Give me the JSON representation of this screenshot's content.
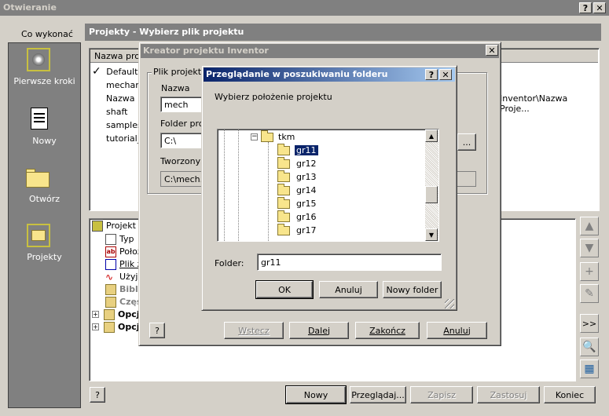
{
  "main_window": {
    "title": "Otwieranie",
    "help_btn": "?",
    "close_btn": "✕"
  },
  "left_panel": {
    "heading": "Co wykonać",
    "items": [
      {
        "label": "Pierwsze kroki",
        "icon": "getting-started-icon"
      },
      {
        "label": "Nowy",
        "icon": "new-document-icon"
      },
      {
        "label": "Otwórz",
        "icon": "open-folder-icon"
      },
      {
        "label": "Projekty",
        "icon": "projects-icon"
      }
    ]
  },
  "projects_panel": {
    "header": "Projekty - Wybierz plik projektu",
    "column_name": "Nazwa projektu",
    "projects": [
      "Default",
      "mechanizm",
      "Nazwa Projektu",
      "shaft",
      "samples",
      "tutorial_files"
    ],
    "path_visible": "Inventor\\Nazwa Proje...",
    "tree": [
      {
        "label": "Projekt",
        "icon": "project-icon",
        "bold": false,
        "expander": ""
      },
      {
        "label": "Typ",
        "icon": "type-icon",
        "bold": false,
        "expander": ""
      },
      {
        "label": "Położenie",
        "icon": "location-icon",
        "bold": false,
        "expander": ""
      },
      {
        "label": "Plik z",
        "icon": "file-icon",
        "bold": false,
        "expander": ""
      },
      {
        "label": "Użyj",
        "icon": "use-icon",
        "bold": false,
        "expander": ""
      },
      {
        "label": "Biblio",
        "icon": "library-icon",
        "bold": true,
        "expander": ""
      },
      {
        "label": "Części",
        "icon": "parts-icon",
        "bold": true,
        "expander": ""
      },
      {
        "label": "Opcje",
        "icon": "options-icon",
        "bold": true,
        "expander": "+"
      },
      {
        "label": "Opcje",
        "icon": "options-icon",
        "bold": true,
        "expander": "+"
      }
    ]
  },
  "bottom_buttons": {
    "help": "?",
    "new": "Nowy",
    "browse": "Przeglądaj...",
    "save": "Zapisz",
    "apply": "Zastosuj",
    "end": "Koniec"
  },
  "wizard": {
    "title": "Kreator projektu Inventor",
    "close_btn": "✕",
    "group_label": "Plik projektu",
    "name_label": "Nazwa",
    "name_value": "mech",
    "folder_label": "Folder projektu",
    "folder_value": "C:\\",
    "created_label": "Tworzony",
    "created_value": "C:\\mech.",
    "browse_btn": "...",
    "buttons": {
      "help": "?",
      "back": "Wstecz",
      "next": "Dalej",
      "finish": "Zakończ",
      "cancel": "Anuluj"
    }
  },
  "folder_dialog": {
    "title": "Przeglądanie w poszukiwaniu folderu",
    "help_btn": "?",
    "close_btn": "✕",
    "prompt": "Wybierz położenie projektu",
    "tree": {
      "parent": "tkm",
      "children": [
        "gr11",
        "gr12",
        "gr13",
        "gr14",
        "gr15",
        "gr16",
        "gr17"
      ],
      "selected": "gr11"
    },
    "folder_label": "Folder:",
    "folder_value": "gr11",
    "ok": "OK",
    "cancel": "Anuluj",
    "new_folder": "Nowy folder"
  },
  "side_buttons": [
    ">>"
  ]
}
